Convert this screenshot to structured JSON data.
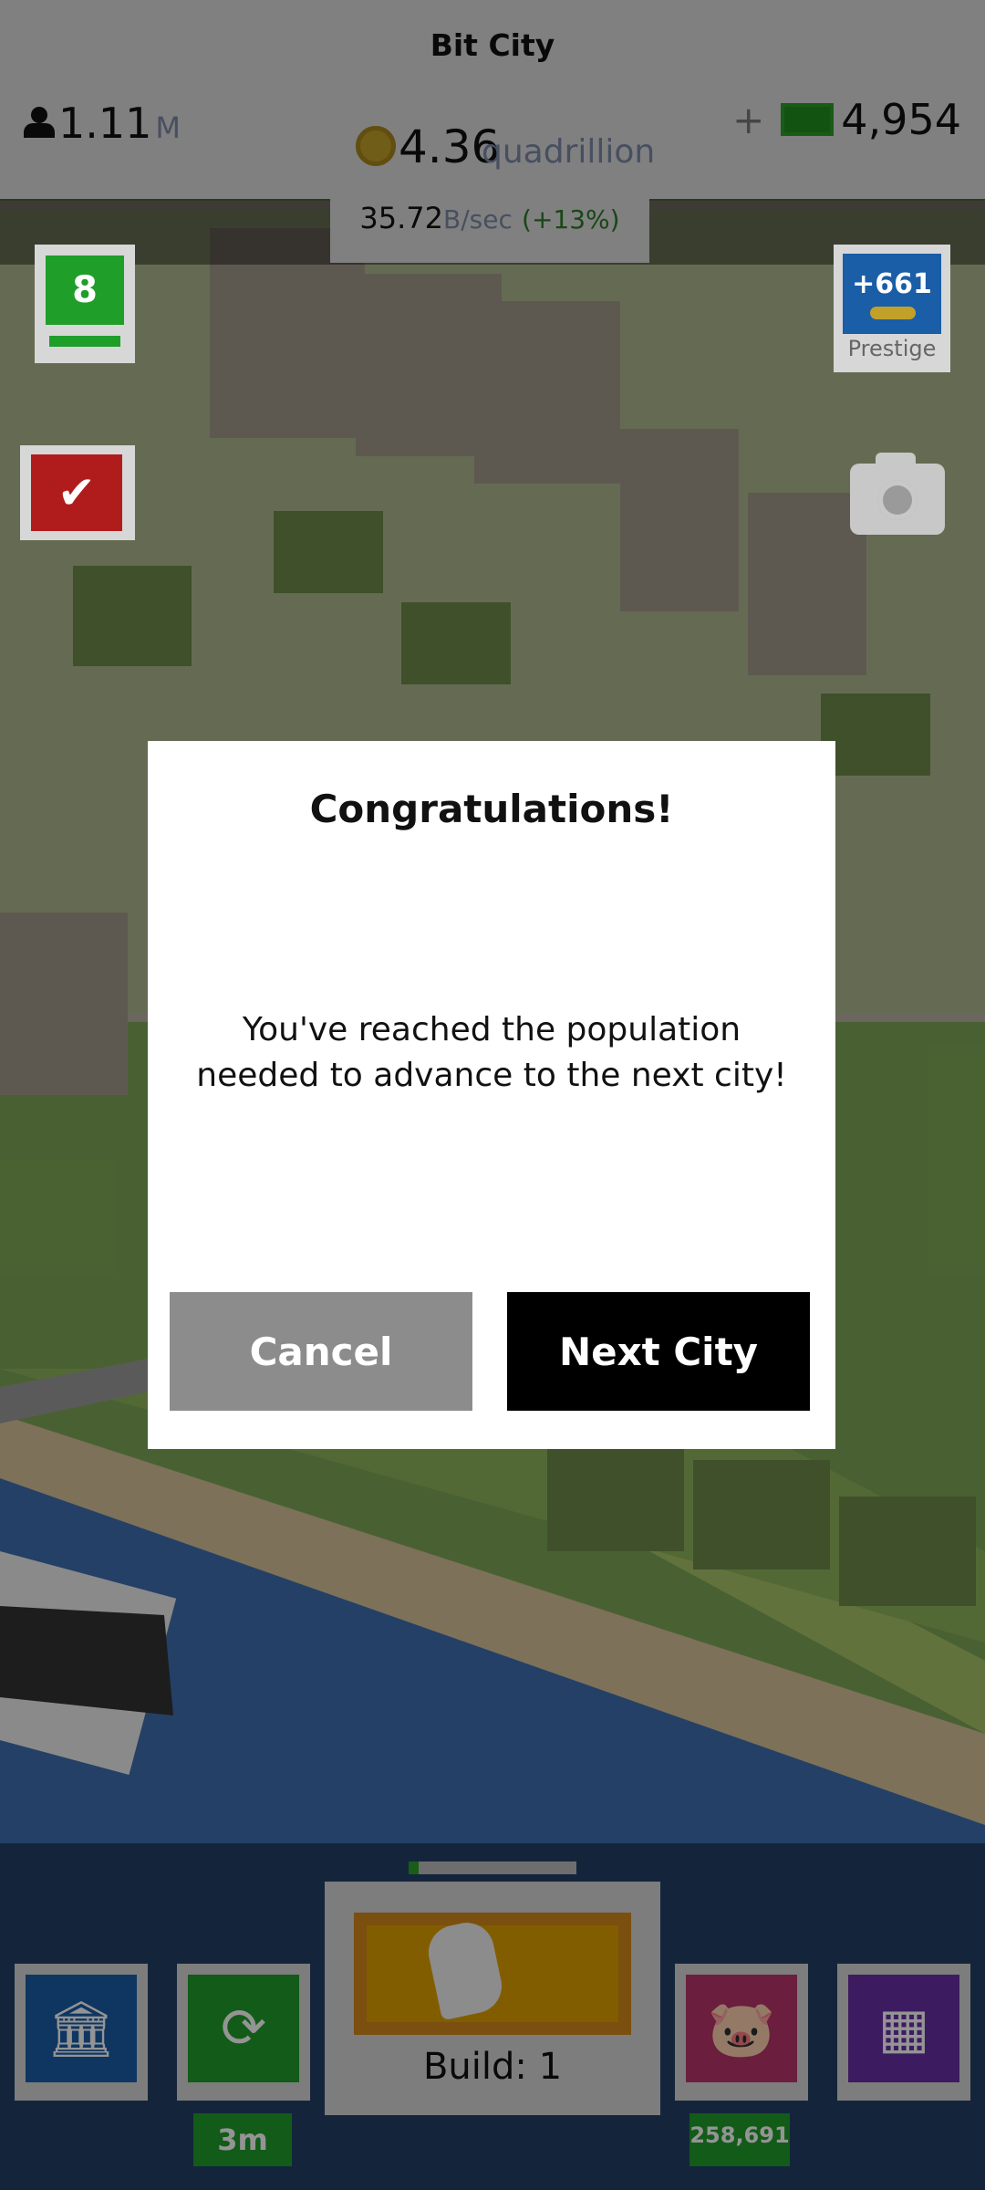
{
  "header": {
    "city_name": "Bit City",
    "population_value": "1.11",
    "population_unit": "M",
    "money_value": "4.36",
    "money_unit": "quadrillion",
    "rate_value": "35.72",
    "rate_unit": "B/sec",
    "rate_bonus": "(+13%)",
    "cash_plus": "+",
    "cash_value": "4,954"
  },
  "side": {
    "level": "8",
    "prestige_value": "+661",
    "prestige_label": "Prestige"
  },
  "bottom": {
    "build_label": "Build: 1",
    "boost_time": "3m",
    "piggy_value": "258,691",
    "build_progress": 0.06
  },
  "dialog": {
    "title": "Congratulations!",
    "message": "You've reached the population needed to advance to the next city!",
    "cancel_label": "Cancel",
    "next_label": "Next City"
  }
}
